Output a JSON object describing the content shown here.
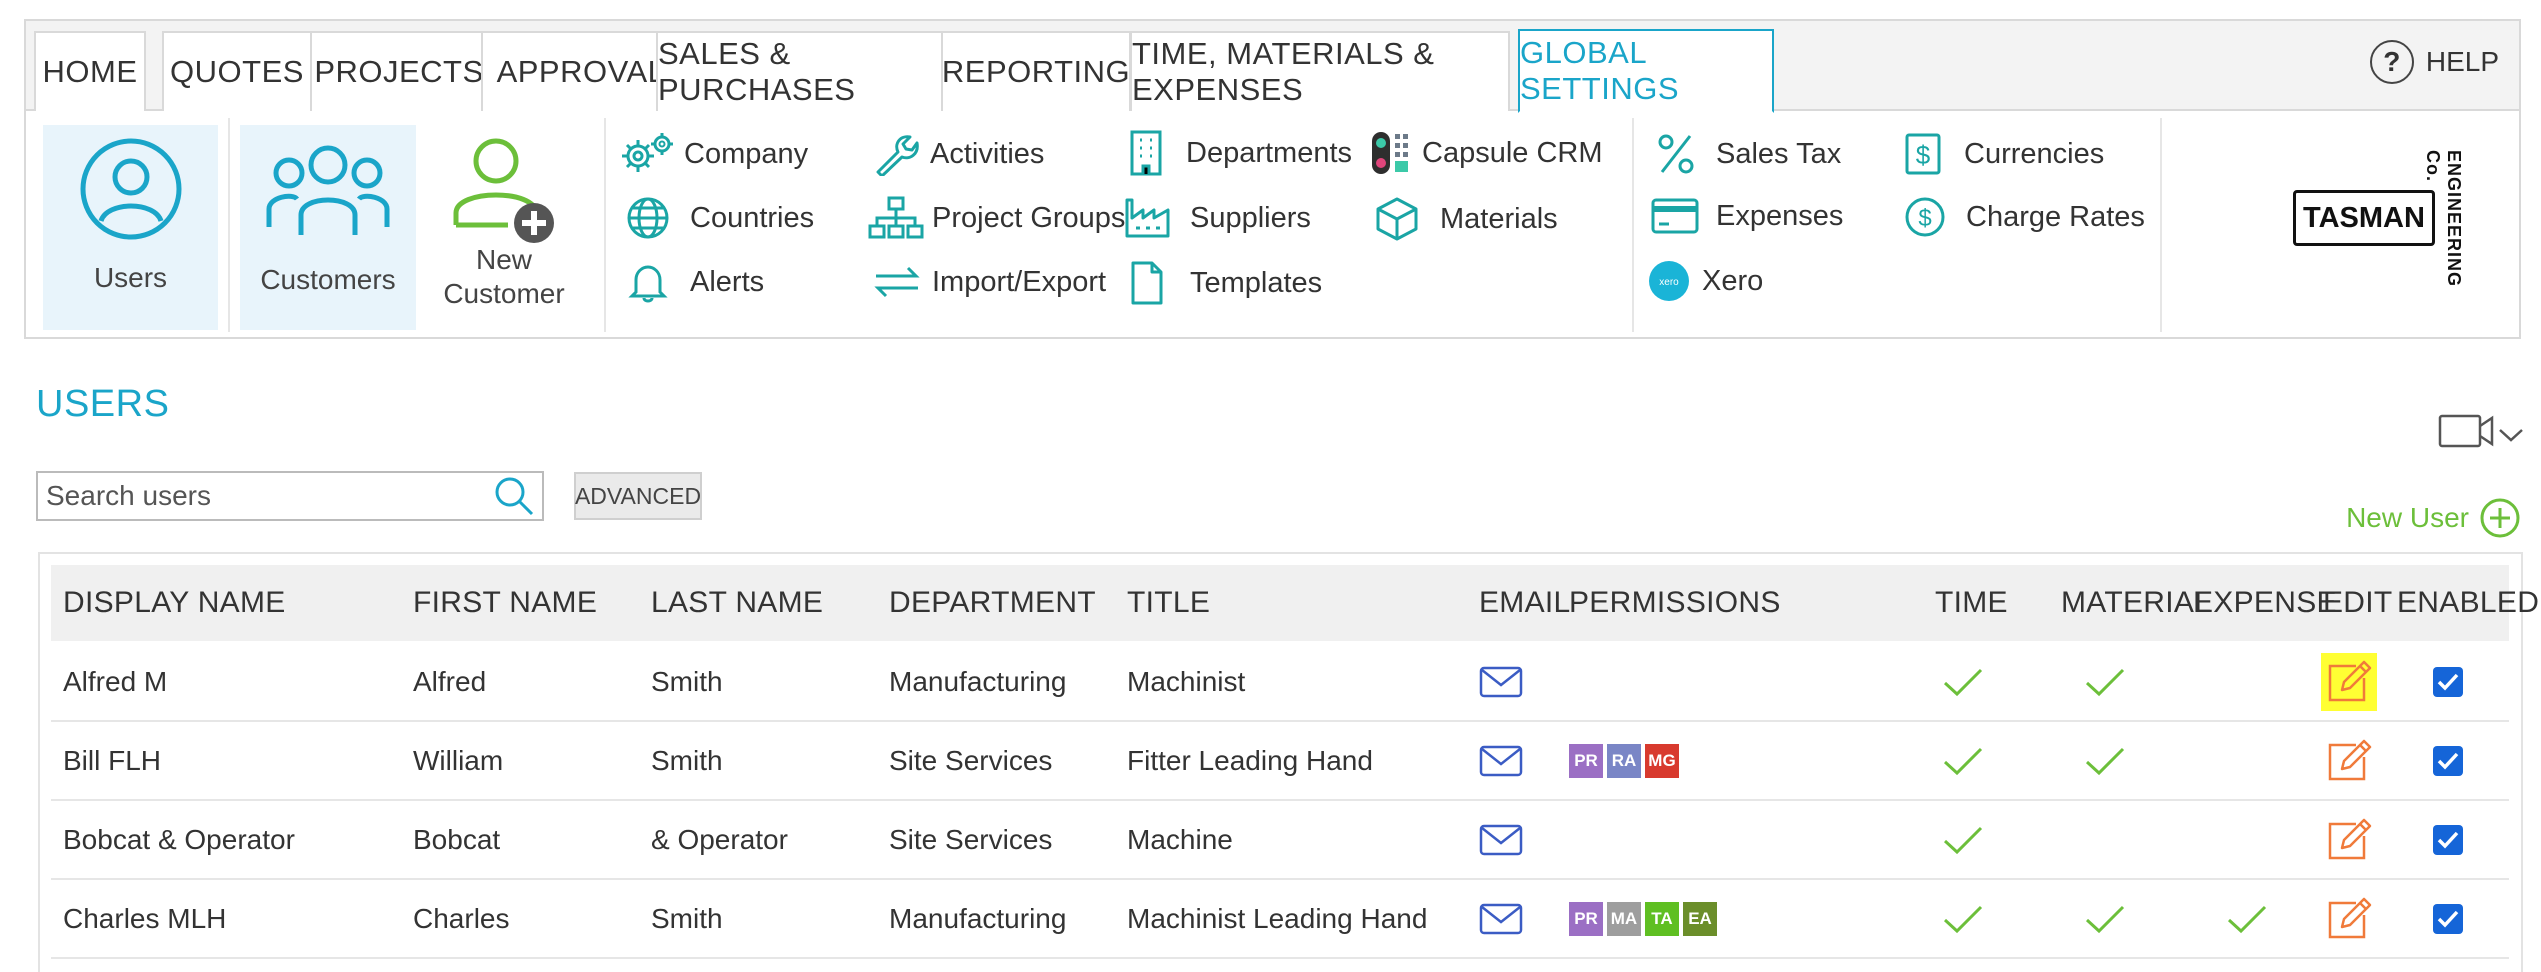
{
  "nav": {
    "tabs": [
      {
        "label": "HOME"
      },
      {
        "label": "QUOTES"
      },
      {
        "label": "PROJECTS"
      },
      {
        "label": "APPROVAL"
      },
      {
        "label": "SALES & PURCHASES"
      },
      {
        "label": "REPORTING"
      },
      {
        "label": "TIME, MATERIALS & EXPENSES"
      },
      {
        "label": "GLOBAL SETTINGS",
        "active": true
      }
    ],
    "help_label": "HELP",
    "accent_color": "#1aa5c9"
  },
  "ribbon": {
    "big_buttons": [
      {
        "label": "Users",
        "selected": true,
        "icon": "user-circle-icon"
      },
      {
        "label": "Customers",
        "selected": true,
        "icon": "people-group-icon"
      },
      {
        "label_line1": "New",
        "label_line2": "Customer",
        "selected": false,
        "icon": "add-person-icon"
      }
    ],
    "items": {
      "company": "Company",
      "countries": "Countries",
      "alerts": "Alerts",
      "activities": "Activities",
      "project_groups": "Project Groups",
      "import_export": "Import/Export",
      "departments": "Departments",
      "suppliers": "Suppliers",
      "templates": "Templates",
      "capsule_crm": "Capsule CRM",
      "materials": "Materials",
      "sales_tax": "Sales Tax",
      "expenses": "Expenses",
      "xero": "Xero",
      "currencies": "Currencies",
      "charge_rates": "Charge Rates"
    },
    "logo": {
      "main": "TASMAN",
      "side": "ENGINEERING Co."
    }
  },
  "page": {
    "title": "USERS",
    "search_placeholder": "Search users",
    "advanced_label": "ADVANCED",
    "new_user_label": "New User"
  },
  "table": {
    "headers": {
      "display_name": "DISPLAY NAME",
      "first_name": "FIRST NAME",
      "last_name": "LAST NAME",
      "department": "DEPARTMENT",
      "title": "TITLE",
      "email": "EMAIL",
      "permissions": "PERMISSIONS",
      "time": "TIME",
      "material": "MATERIAL",
      "expense": "EXPENSE",
      "edit": "EDIT",
      "enabled": "ENABLED"
    },
    "rows": [
      {
        "display_name": "Alfred M",
        "first_name": "Alfred",
        "last_name": "Smith",
        "department": "Manufacturing",
        "title": "Machinist",
        "permissions": [],
        "time": true,
        "material": true,
        "expense": false,
        "enabled": true,
        "edit_highlighted": true
      },
      {
        "display_name": "Bill FLH",
        "first_name": "William",
        "last_name": "Smith",
        "department": "Site Services",
        "title": "Fitter Leading Hand",
        "permissions": [
          {
            "code": "PR",
            "color": "#9b6fc4"
          },
          {
            "code": "RA",
            "color": "#7a86c6"
          },
          {
            "code": "MG",
            "color": "#d83a2e"
          }
        ],
        "time": true,
        "material": true,
        "expense": false,
        "enabled": true,
        "edit_highlighted": false
      },
      {
        "display_name": "Bobcat & Operator",
        "first_name": "Bobcat",
        "last_name": "& Operator",
        "department": "Site Services",
        "title": "Machine",
        "permissions": [],
        "time": true,
        "material": false,
        "expense": false,
        "enabled": true,
        "edit_highlighted": false
      },
      {
        "display_name": "Charles MLH",
        "first_name": "Charles",
        "last_name": "Smith",
        "department": "Manufacturing",
        "title": "Machinist Leading Hand",
        "permissions": [
          {
            "code": "PR",
            "color": "#9b6fc4"
          },
          {
            "code": "MA",
            "color": "#9e9e9e"
          },
          {
            "code": "TA",
            "color": "#5fbf22"
          },
          {
            "code": "EA",
            "color": "#6b8e2a"
          }
        ],
        "time": true,
        "material": true,
        "expense": true,
        "enabled": true,
        "edit_highlighted": false
      }
    ]
  },
  "colors": {
    "check_green": "#6cbf3a",
    "edit_orange": "#f07a3a",
    "email_blue": "#3b5cc4",
    "checkbox_blue": "#1565d8",
    "highlight": "#ffff33",
    "teal_icon": "#1aa5a5"
  }
}
